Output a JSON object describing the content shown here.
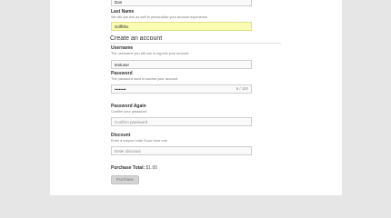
{
  "first_name": {
    "value": "Dan"
  },
  "last_name": {
    "label": "Last Name",
    "hint": "We will use this as well to personalize your account experience.",
    "value": "Griffiths"
  },
  "create_account": {
    "title": "Create an account"
  },
  "username": {
    "label": "Username",
    "hint": "The username you will use to log into your account",
    "value": "testuser"
  },
  "password": {
    "label": "Password",
    "hint": "The password used to access your account",
    "value": "••••••••",
    "strength_label": "8 / 100"
  },
  "password_again": {
    "label": "Password Again",
    "hint": "Confirm your password",
    "placeholder": "Confirm password"
  },
  "discount": {
    "label": "Discount",
    "hint": "Enter a coupon code if you have one",
    "placeholder": "Enter discount"
  },
  "purchase": {
    "total_label": "Purchase Total:",
    "total_value": "$1.00",
    "button_label": "Purchase"
  },
  "colors": {
    "page_background": "#e6e6e6",
    "panel_background": "#ffffff",
    "highlight_field": "#fbfcb3",
    "button_background": "#d4d4d4"
  }
}
